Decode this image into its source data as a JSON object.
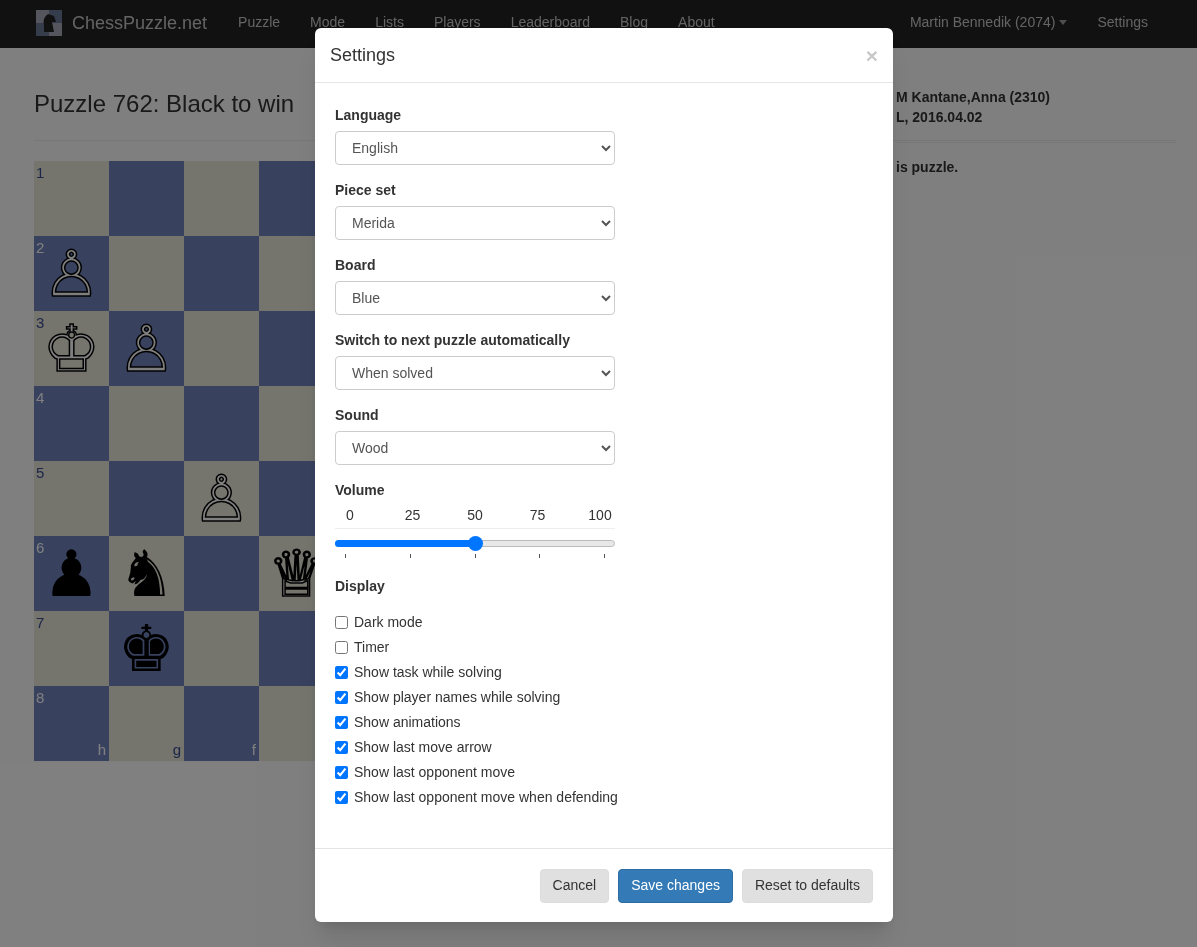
{
  "navbar": {
    "brand": "ChessPuzzle.net",
    "links": [
      "Puzzle",
      "Mode",
      "Lists",
      "Players",
      "Leaderboard",
      "Blog",
      "About"
    ],
    "user": "Martin Bennedik (2074)",
    "settings": "Settings"
  },
  "puzzle": {
    "title": "Puzzle 762: Black to win",
    "players": "M Kantane,Anna (2310)",
    "event": "L, 2016.04.02",
    "note": "is puzzle."
  },
  "board": {
    "files": [
      "h",
      "g",
      "f"
    ],
    "ranks": [
      {
        "label": "1",
        "squares": [
          {
            "kind": "empty"
          },
          {
            "kind": "empty"
          },
          {
            "kind": "empty"
          },
          {
            "kind": "empty"
          }
        ]
      },
      {
        "label": "2",
        "squares": [
          {
            "kind": "white",
            "glyph": "♙"
          },
          {
            "kind": "empty"
          },
          {
            "kind": "empty"
          },
          {
            "kind": "empty"
          }
        ]
      },
      {
        "label": "3",
        "squares": [
          {
            "kind": "white",
            "glyph": "♔"
          },
          {
            "kind": "white",
            "glyph": "♙"
          },
          {
            "kind": "empty"
          },
          {
            "kind": "empty"
          }
        ]
      },
      {
        "label": "4",
        "squares": [
          {
            "kind": "empty"
          },
          {
            "kind": "empty"
          },
          {
            "kind": "empty"
          },
          {
            "kind": "empty"
          }
        ]
      },
      {
        "label": "5",
        "squares": [
          {
            "kind": "empty"
          },
          {
            "kind": "empty"
          },
          {
            "kind": "white",
            "glyph": "♙"
          },
          {
            "kind": "empty"
          }
        ]
      },
      {
        "label": "6",
        "squares": [
          {
            "kind": "black",
            "glyph": "♟"
          },
          {
            "kind": "black",
            "glyph": "♞"
          },
          {
            "kind": "empty"
          },
          {
            "kind": "white",
            "glyph": "♕"
          }
        ]
      },
      {
        "label": "7",
        "squares": [
          {
            "kind": "empty"
          },
          {
            "kind": "black",
            "glyph": "♚"
          },
          {
            "kind": "empty"
          },
          {
            "kind": "empty"
          }
        ]
      },
      {
        "label": "8",
        "squares": [
          {
            "kind": "empty"
          },
          {
            "kind": "empty"
          },
          {
            "kind": "empty"
          },
          {
            "kind": "empty"
          }
        ]
      }
    ]
  },
  "modal": {
    "title": "Settings",
    "close": "×",
    "selects": [
      {
        "label": "Language",
        "value": "English"
      },
      {
        "label": "Piece set",
        "value": "Merida"
      },
      {
        "label": "Board",
        "value": "Blue"
      },
      {
        "label": "Switch to next puzzle automatically",
        "value": "When solved"
      },
      {
        "label": "Sound",
        "value": "Wood"
      }
    ],
    "volume": {
      "label": "Volume",
      "ticks": [
        "0",
        "25",
        "50",
        "75",
        "100"
      ],
      "level": 0.5
    },
    "display": {
      "label": "Display",
      "options": [
        {
          "label": "Dark mode",
          "checked": false
        },
        {
          "label": "Timer",
          "checked": false
        },
        {
          "label": "Show task while solving",
          "checked": true
        },
        {
          "label": "Show player names while solving",
          "checked": true
        },
        {
          "label": "Show animations",
          "checked": true
        },
        {
          "label": "Show last move arrow",
          "checked": true
        },
        {
          "label": "Show last opponent move",
          "checked": true
        },
        {
          "label": "Show last opponent move when defending",
          "checked": true
        }
      ]
    },
    "buttons": [
      {
        "label": "Cancel",
        "kind": "default"
      },
      {
        "label": "Save changes",
        "kind": "primary"
      },
      {
        "label": "Reset to defaults",
        "kind": "default"
      }
    ]
  }
}
